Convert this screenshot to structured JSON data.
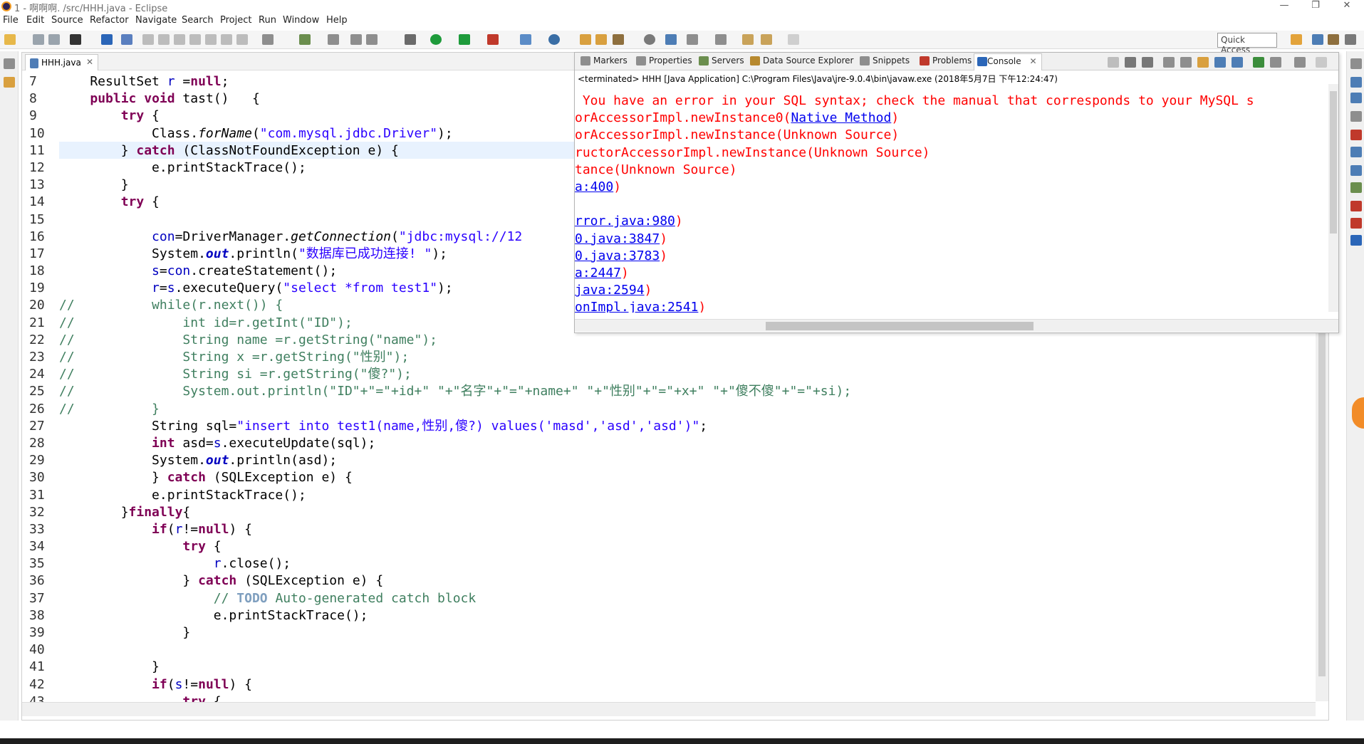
{
  "window": {
    "title": "1 - 啊啊啊. /src/HHH.java - Eclipse",
    "controls": [
      "—",
      "❐",
      "✕"
    ]
  },
  "menu": [
    "File",
    "Edit",
    "Source",
    "Refactor",
    "Navigate",
    "Search",
    "Project",
    "Run",
    "Window",
    "Help"
  ],
  "quick_access": "Quick Access",
  "editor": {
    "tab_label": "HHH.java",
    "tab_close": "✕",
    "line_numbers": [
      "7",
      "8",
      "9",
      "10",
      "11",
      "12",
      "13",
      "14",
      "15",
      "16",
      "17",
      "18",
      "19",
      "20",
      "21",
      "22",
      "23",
      "24",
      "25",
      "26",
      "27",
      "28",
      "29",
      "30",
      "31",
      "32",
      "33",
      "34",
      "35",
      "36",
      "37",
      "38",
      "39",
      "40",
      "41",
      "42",
      "43"
    ]
  },
  "console": {
    "tabs": [
      "Markers",
      "Properties",
      "Servers",
      "Data Source Explorer",
      "Snippets",
      "Problems",
      "Console"
    ],
    "active_tab": "Console",
    "status": "<terminated> HHH [Java Application] C:\\Program Files\\Java\\jre-9.0.4\\bin\\javaw.exe (2018年5月7日 下午12:24:47)",
    "error_lines": [
      {
        "text": " You have an error in your SQL syntax; check the manual that corresponds to your MySQL s",
        "link": ""
      },
      {
        "text": "orAccessorImpl.newInstance0(",
        "link": "Native Method",
        "suffix": ")"
      },
      {
        "text": "orAccessorImpl.newInstance(Unknown Source)",
        "link": ""
      },
      {
        "text": "ructorAccessorImpl.newInstance(Unknown Source)",
        "link": ""
      },
      {
        "text": "tance(Unknown Source)",
        "link": ""
      },
      {
        "text": "",
        "link": "a:400",
        "suffix": ")"
      },
      {
        "text": "",
        "link": ""
      },
      {
        "text": "",
        "link": "rror.java:980",
        "suffix": ")"
      },
      {
        "text": "",
        "link": "0.java:3847",
        "suffix": ")"
      },
      {
        "text": "",
        "link": "0.java:3783",
        "suffix": ")"
      },
      {
        "text": "",
        "link": "a:2447",
        "suffix": ")"
      },
      {
        "text": "",
        "link": "java:2594",
        "suffix": ")"
      },
      {
        "text": "",
        "link": "onImpl.java:2541",
        "suffix": ")"
      }
    ]
  }
}
